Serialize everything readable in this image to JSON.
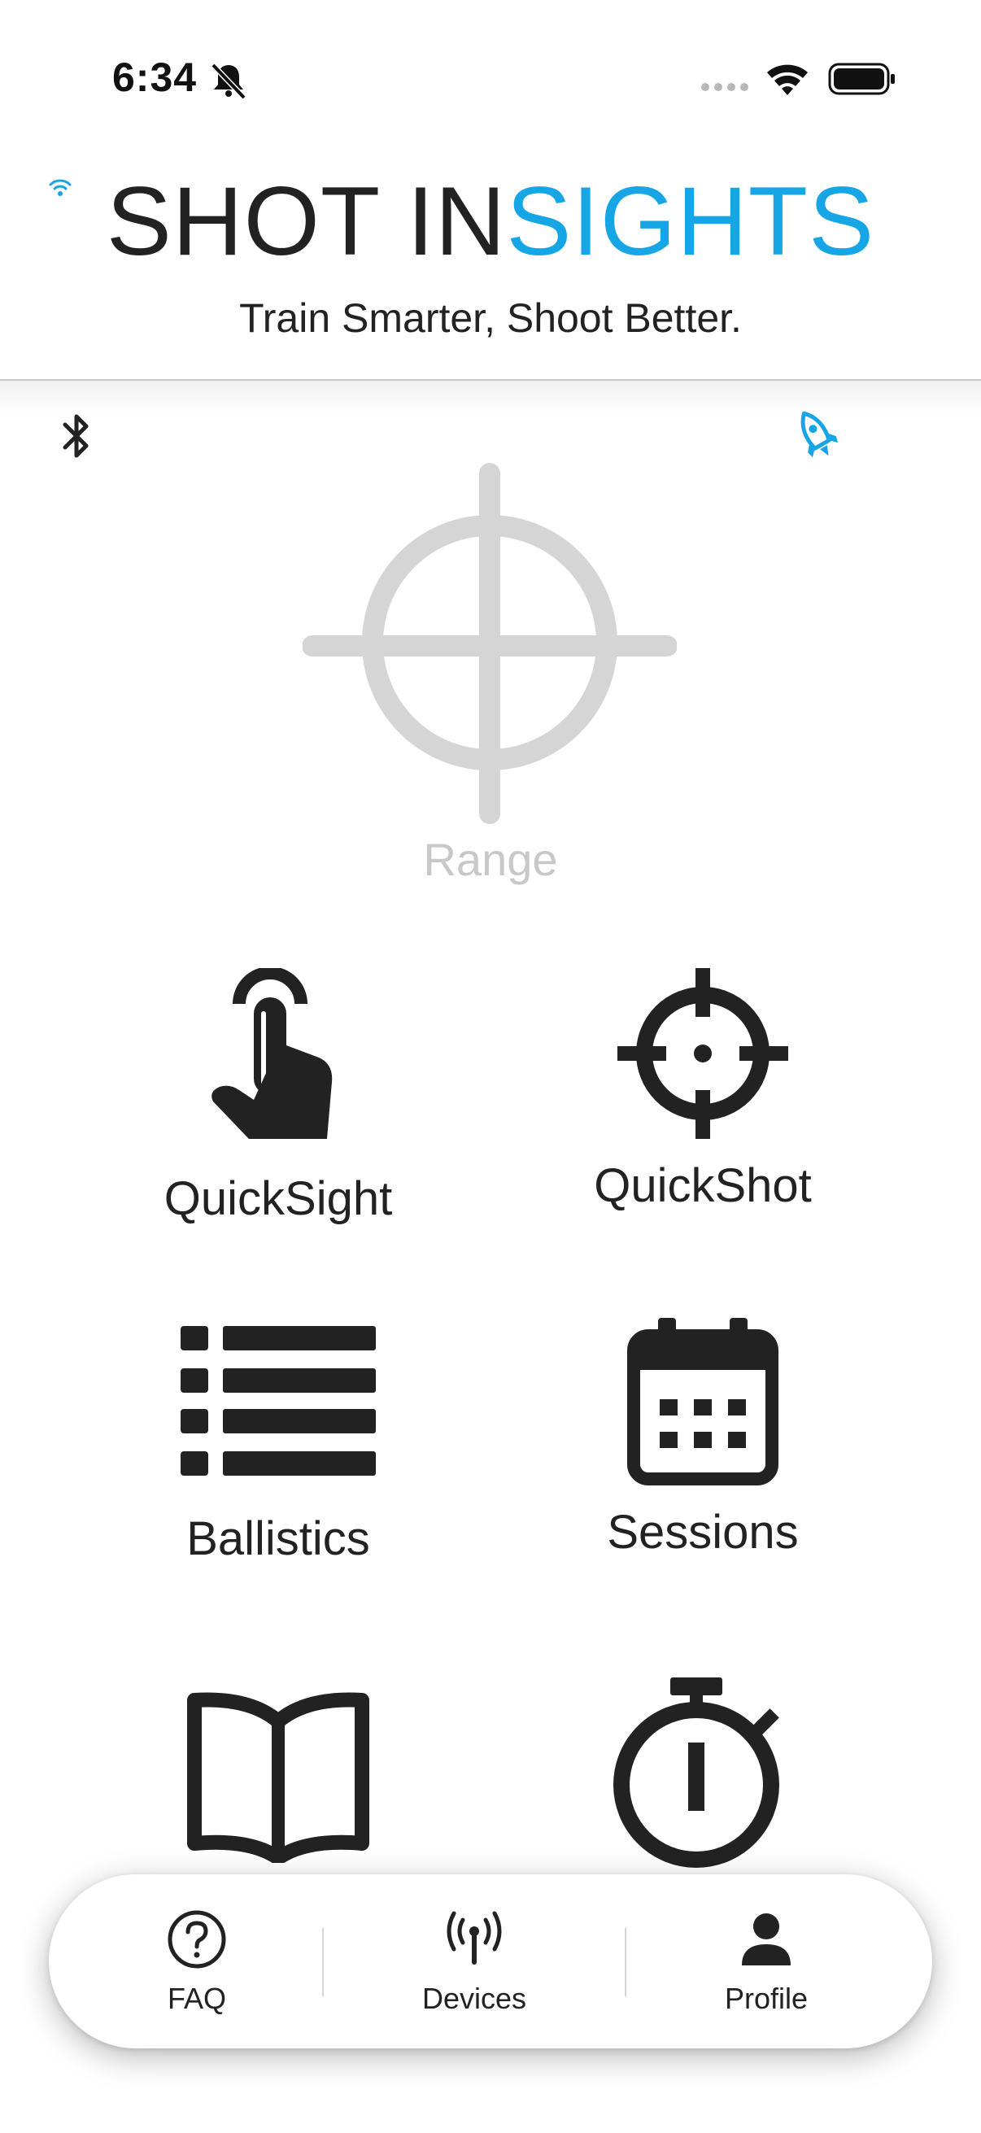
{
  "status_bar": {
    "time": "6:34",
    "icons": [
      "bell-slash-icon",
      "signal-dots-icon",
      "wifi-icon",
      "battery-icon"
    ]
  },
  "header": {
    "title_dark": "SHOT IN",
    "title_accent": "SIGHTS",
    "tagline": "Train Smarter, Shoot Better.",
    "colors": {
      "accent": "#17a6e5",
      "text": "#222222"
    }
  },
  "toolbar": {
    "left_icon": "bluetooth-icon",
    "right_icon": "rocket-icon"
  },
  "range": {
    "label": "Range",
    "icon": "crosshair-icon",
    "state": "disabled"
  },
  "grid": {
    "items": [
      {
        "label": "QuickSight",
        "icon": "hand-pointer-icon"
      },
      {
        "label": "QuickShot",
        "icon": "crosshairs-icon"
      },
      {
        "label": "Ballistics",
        "icon": "list-icon"
      },
      {
        "label": "Sessions",
        "icon": "calendar-icon"
      },
      {
        "label": "",
        "icon": "book-icon"
      },
      {
        "label": "",
        "icon": "stopwatch-icon"
      }
    ]
  },
  "tabbar": {
    "tabs": [
      {
        "label": "FAQ",
        "icon": "question-circle-icon"
      },
      {
        "label": "Devices",
        "icon": "antenna-icon"
      },
      {
        "label": "Profile",
        "icon": "person-icon"
      }
    ]
  }
}
